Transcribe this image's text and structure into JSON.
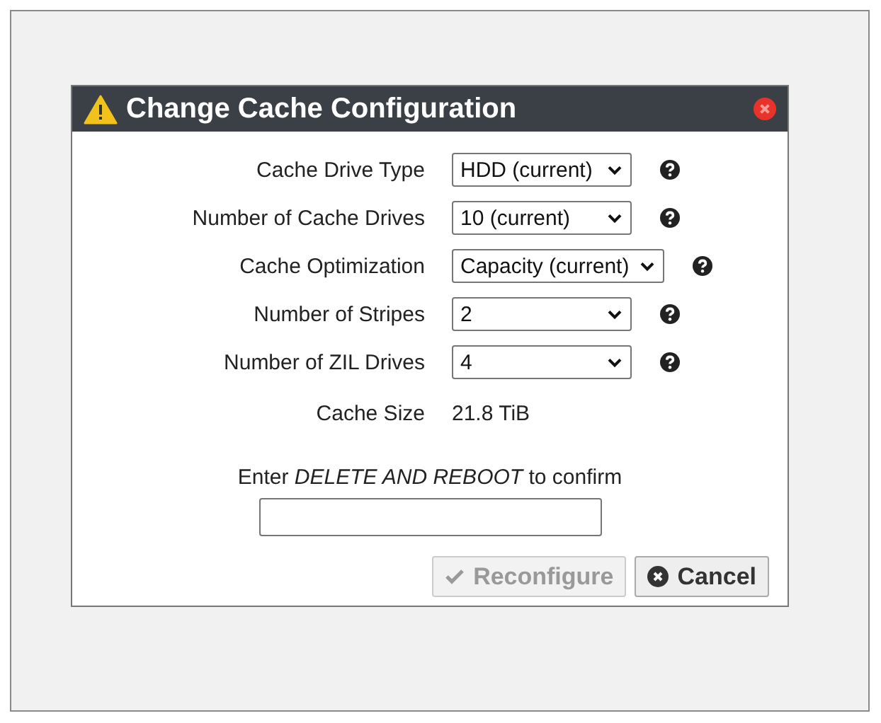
{
  "dialog": {
    "title": "Change Cache Configuration",
    "fields": [
      {
        "label": "Cache Drive Type",
        "kind": "select",
        "value": "HDD (current)"
      },
      {
        "label": "Number of Cache Drives",
        "kind": "select",
        "value": "10 (current)"
      },
      {
        "label": "Cache Optimization",
        "kind": "select",
        "value": "Capacity (current)"
      },
      {
        "label": "Number of Stripes",
        "kind": "select",
        "value": "2"
      },
      {
        "label": "Number of ZIL Drives",
        "kind": "select",
        "value": "4"
      },
      {
        "label": "Cache Size",
        "kind": "readout",
        "value": "21.8 TiB"
      }
    ],
    "confirm_prompt": "Enter *DELETE AND REBOOT* to confirm",
    "buttons": [
      {
        "label": "Reconfigure",
        "kind": "confirm",
        "disabled": true
      },
      {
        "label": "Cancel",
        "kind": "cancel",
        "disabled": false
      }
    ]
  }
}
